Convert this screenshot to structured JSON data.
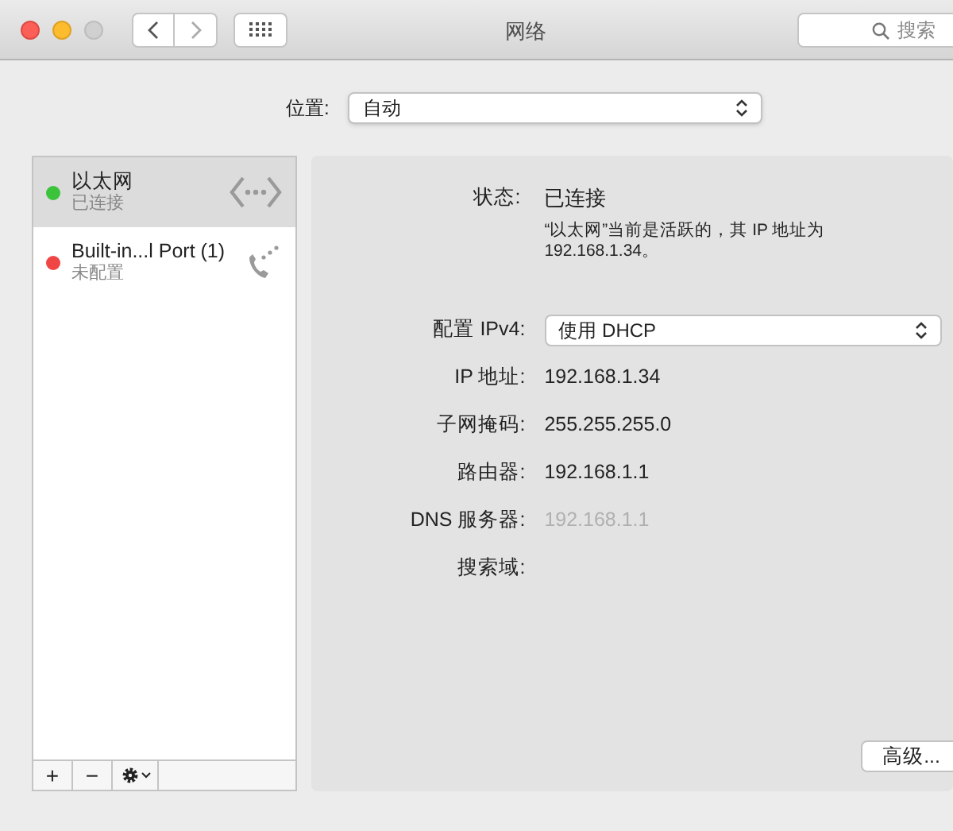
{
  "window": {
    "title": "网络",
    "search_placeholder": "搜索"
  },
  "location": {
    "label": "位置:",
    "value": "自动"
  },
  "services": [
    {
      "name": "以太网",
      "status": "已连接",
      "color": "#3bc43b",
      "selected": true,
      "kind": "ethernet"
    },
    {
      "name": "Built-in...l Port (1)",
      "status": "未配置",
      "color": "#f04545",
      "selected": false,
      "kind": "phone"
    }
  ],
  "service_toolbar": [
    "+",
    "−"
  ],
  "details": {
    "status_label": "状态:",
    "status_value": "已连接",
    "status_description": "“以太网”当前是活跃的，其 IP 地址为 192.168.1.34。",
    "fields": [
      {
        "kind": "select",
        "label": "配置 IPv4:",
        "value": "使用 DHCP"
      },
      {
        "kind": "text",
        "label": "IP 地址:",
        "value": "192.168.1.34"
      },
      {
        "kind": "text",
        "label": "子网掩码:",
        "value": "255.255.255.0"
      },
      {
        "kind": "text",
        "label": "路由器:",
        "value": "192.168.1.1"
      },
      {
        "kind": "text",
        "label": "DNS 服务器:",
        "placeholder": "192.168.1.1"
      },
      {
        "kind": "text",
        "label": "搜索域:"
      }
    ],
    "advanced_button": "高级..."
  }
}
